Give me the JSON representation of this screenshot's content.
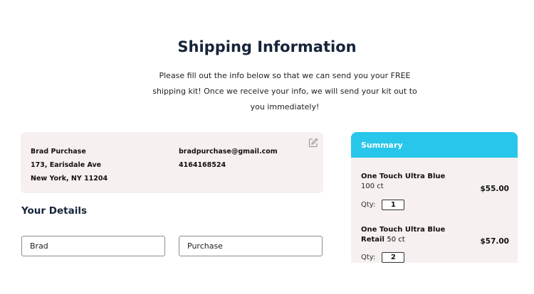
{
  "page": {
    "title": "Shipping Information",
    "intro_line1": "Please fill out the info below so that we can send you your FREE",
    "intro_line2": "shipping kit! Once we receive your info, we will send your kit out to",
    "intro_line3": "you immediately!"
  },
  "address": {
    "name": "Brad Purchase",
    "street": "173, Earisdale Ave",
    "city_line": "New York, NY 11204",
    "email": "bradpurchase@gmail.com",
    "phone": "4164168524",
    "edit_icon": "edit-icon"
  },
  "details": {
    "title": "Your Details",
    "first_name_value": "Brad",
    "last_name_value": "Purchase"
  },
  "summary": {
    "title": "Summary",
    "header_color": "#27c6ea",
    "qty_label": "Qty:",
    "items": [
      {
        "name": "One Touch Ultra Blue",
        "size": "100 ct",
        "price": "$55.00",
        "qty": "1"
      },
      {
        "name": "One Touch Ultra Blue Retail",
        "size": "50 ct",
        "price": "$57.00",
        "qty": "2"
      }
    ]
  }
}
